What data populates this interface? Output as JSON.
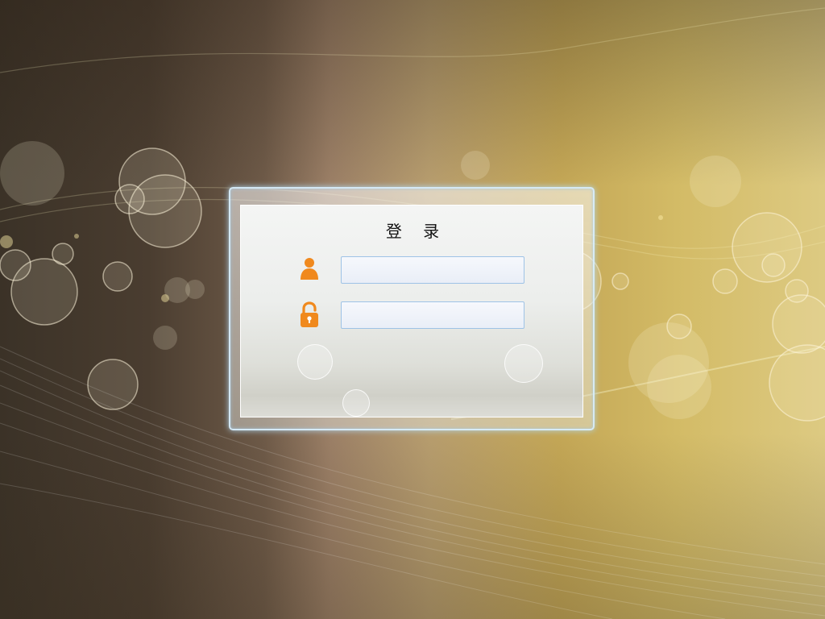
{
  "login": {
    "title": "登 录",
    "username_field": {
      "value": "",
      "placeholder": ""
    },
    "password_field": {
      "value": "",
      "placeholder": ""
    }
  },
  "icons": {
    "username": "user-icon",
    "password": "padlock-icon"
  },
  "colors": {
    "icon_accent": "#f0891d",
    "input_border": "#9ec3e6",
    "frame_glow": "#d6ecfa"
  }
}
